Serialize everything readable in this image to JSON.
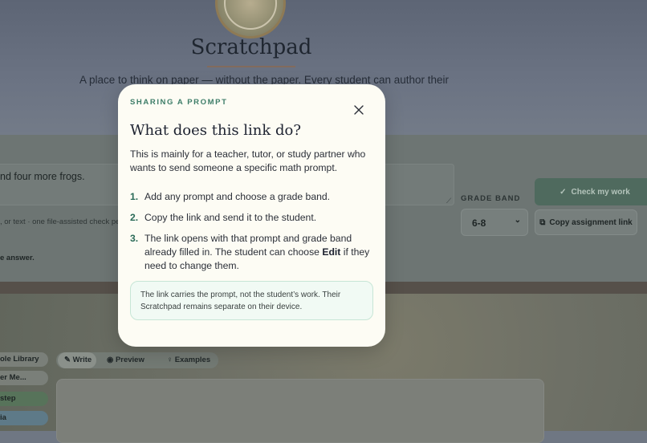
{
  "background": {
    "title": "Scratchpad",
    "subtitle": "A place to think on paper — without the paper. Every student can author their",
    "problem_fragment": "nd four more frogs.",
    "hint_fragment": ", or text · one file-assisted check per",
    "answer_fragment": "e answer.",
    "grade_band_label": "GRADE BAND",
    "grade_band_value": "6-8",
    "check_button": "Check my work",
    "copy_button": "Copy assignment link",
    "sidebar": [
      "ole Library",
      "er Me...",
      "step",
      "ia"
    ],
    "tabs": [
      "Write",
      "Preview",
      "Examples"
    ]
  },
  "modal": {
    "eyebrow": "SHARING A PROMPT",
    "title": "What does this link do?",
    "intro": "This is mainly for a teacher, tutor, or study partner who wants to send someone a specific math prompt.",
    "steps": [
      {
        "num": "1.",
        "text": "Add any prompt and choose a grade band."
      },
      {
        "num": "2.",
        "text": "Copy the link and send it to the student."
      },
      {
        "num": "3.",
        "text_before": "The link opens with that prompt and grade band already filled in. The student can choose ",
        "bold": "Edit",
        "text_after": " if they need to change them."
      }
    ],
    "note": "The link carries the prompt, not the student’s work. Their Scratchpad remains separate on their device."
  },
  "colors": {
    "accent": "#3d7d68",
    "modal_bg": "#fdfcf4",
    "note_bg": "#f1faf4",
    "note_border": "#c7e6d6"
  },
  "icons": {
    "close": "close-icon",
    "check": "check-icon",
    "copy": "copy-icon",
    "pencil": "pencil-icon",
    "eye": "eye-icon",
    "bulb": "lightbulb-icon",
    "chevron": "chevron-down-icon"
  }
}
